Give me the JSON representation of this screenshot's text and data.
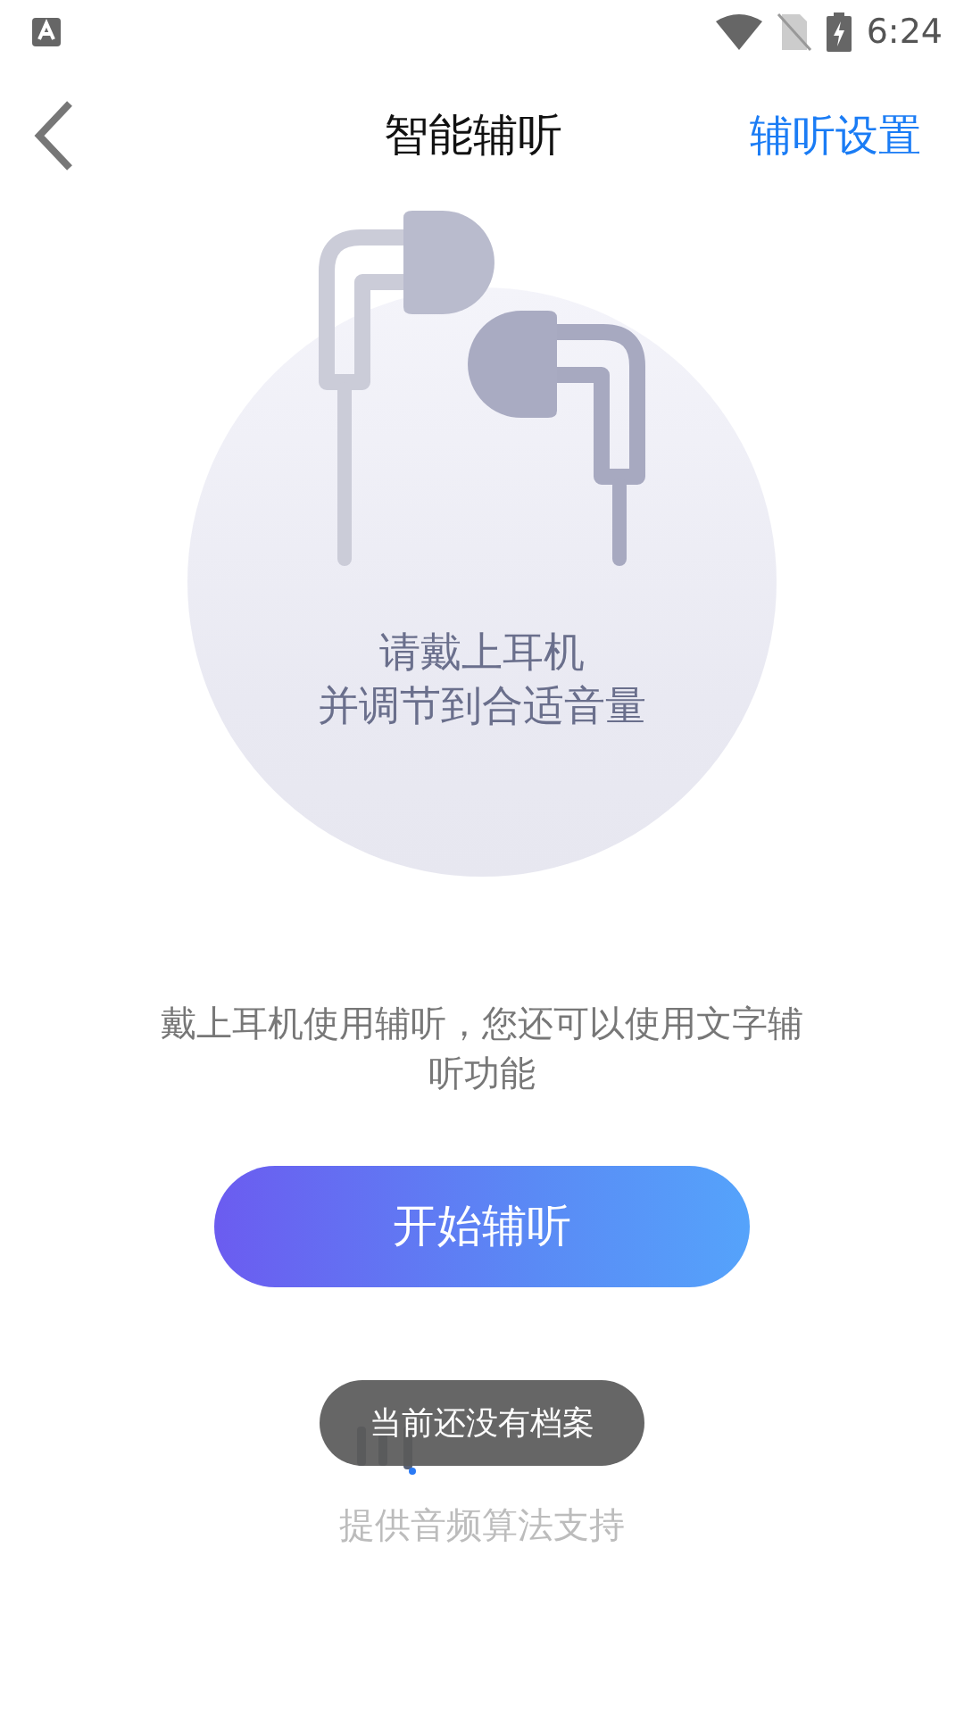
{
  "status_bar": {
    "time": "6:24"
  },
  "header": {
    "title": "智能辅听",
    "action": "辅听设置"
  },
  "hero": {
    "lines": [
      "请戴上耳机",
      "并调节到合适音量"
    ]
  },
  "hint": "戴上耳机使用辅听，您还可以使用文字辅听功能",
  "start_button": "开始辅听",
  "toast": "当前还没有档案",
  "footer": "提供音频算法支持"
}
